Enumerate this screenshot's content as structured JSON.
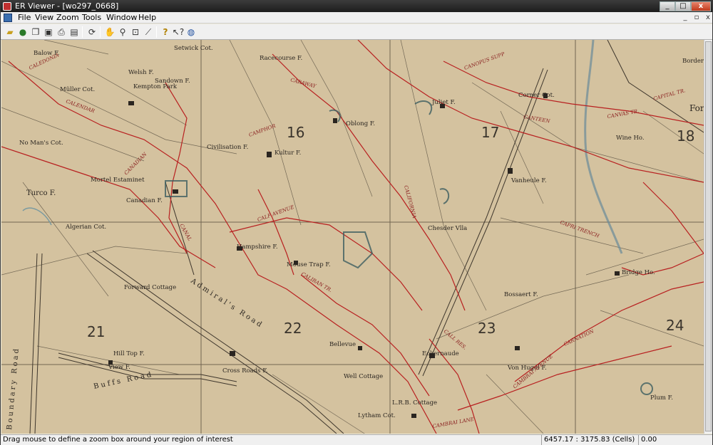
{
  "window": {
    "title": "ER Viewer - [wo297_0668]",
    "min": "_",
    "max": "□",
    "close": "x"
  },
  "menu": {
    "items": [
      "File",
      "View",
      "Zoom",
      "Tools",
      "Window",
      "Help"
    ],
    "mdi_min": "_",
    "mdi_restore": "▫",
    "mdi_close": "x"
  },
  "toolbar": {
    "icons": [
      "open-folder-icon",
      "globe-icon",
      "copy-icon",
      "save-icon",
      "print-icon",
      "print-preview-icon",
      "refresh-icon",
      "pan-hand-icon",
      "zoom-icon",
      "zoom-box-icon",
      "measure-icon",
      "help-icon",
      "whats-this-icon",
      "web-icon"
    ]
  },
  "map": {
    "places": [
      "Balow F.",
      "Welsh F.",
      "Sandown F.",
      "Kempton Park",
      "Müller Cot.",
      "Racecourse F.",
      "Setwick Cot.",
      "Juliet F.",
      "Corner Cot.",
      "Border",
      "For",
      "Oblong F.",
      "Kultur F.",
      "Civilisation F.",
      "No Man's Cot.",
      "Mortel Estaminet",
      "Turco F.",
      "Canadian F.",
      "Algerian Cot.",
      "Hampshire F.",
      "Mouse Trap F.",
      "Chesder Vlla",
      "Vanheule F.",
      "Wine Ho.",
      "Bridge Ho.",
      "Forward Cottage",
      "Hill Top F.",
      "View F.",
      "Cross Roads F.",
      "Bellevue",
      "Well Cottage",
      "Lytham Cot.",
      "L.R.B. Cottage",
      "Eckernaude",
      "Bossaert F.",
      "Von Hugel F.",
      "Plum F."
    ],
    "grid_numbers": [
      "16",
      "17",
      "18",
      "21",
      "22",
      "23",
      "24"
    ],
    "trenches": [
      "CALEDONIA",
      "CALENDAR",
      "CANADIAN",
      "CAMPHOR",
      "CARAWAY",
      "CANOPUS SUPP",
      "CANTEEN",
      "CANVAS TR.",
      "CAPITAL TR.",
      "CALIFORNIA",
      "CALL RES.",
      "CALF AVENUE",
      "CALIBAN TR.",
      "CANAL",
      "CARNATION",
      "CAMBRAI LANE",
      "CAMBRAI AVENUE",
      "CAPRI TRENCH"
    ],
    "roads": [
      "Admiral's Road",
      "Buffs Road",
      "Boundary Road"
    ]
  },
  "status": {
    "message": "Drag mouse to define a zoom box around your region of interest",
    "coords": "6457.17 : 3175.83 (Cells)",
    "value": "0.00"
  }
}
